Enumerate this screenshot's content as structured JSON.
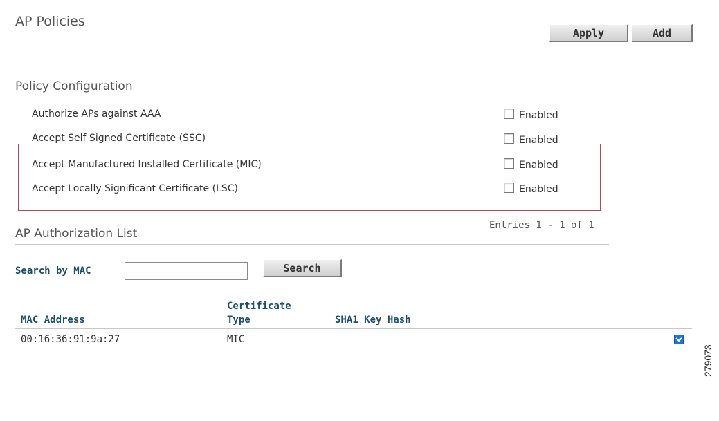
{
  "page": {
    "title": "AP Policies",
    "apply_label": "Apply",
    "add_label": "Add"
  },
  "policy_config": {
    "title": "Policy Configuration",
    "rows": [
      {
        "label": "Authorize APs against AAA",
        "checkbox_label": "Enabled",
        "checked": false
      },
      {
        "label": "Accept Self Signed Certificate (SSC)",
        "checkbox_label": "Enabled",
        "checked": false
      },
      {
        "label": "Accept Manufactured Installed Certificate (MIC)",
        "checkbox_label": "Enabled",
        "checked": false
      },
      {
        "label": "Accept Locally Significant Certificate (LSC)",
        "checkbox_label": "Enabled",
        "checked": false
      }
    ],
    "highlight_color": "#b8474f"
  },
  "auth_list": {
    "title": "AP Authorization List",
    "entries_text": "Entries 1 - 1 of 1",
    "search_label": "Search by MAC",
    "search_value": "",
    "search_button_label": "Search",
    "columns": {
      "mac": "MAC Address",
      "cert_line1": "Certificate",
      "cert_line2": "Type",
      "sha1": "SHA1 Key Hash"
    },
    "rows": [
      {
        "mac": "00:16:36:91:9a:27",
        "cert_type": "MIC",
        "sha1": "",
        "menu_icon": "dropdown-arrow-icon"
      }
    ]
  },
  "figure_id": "279073",
  "colors": {
    "header_text": "#1c4f6e",
    "dropdown_icon": "#1b77cf"
  }
}
